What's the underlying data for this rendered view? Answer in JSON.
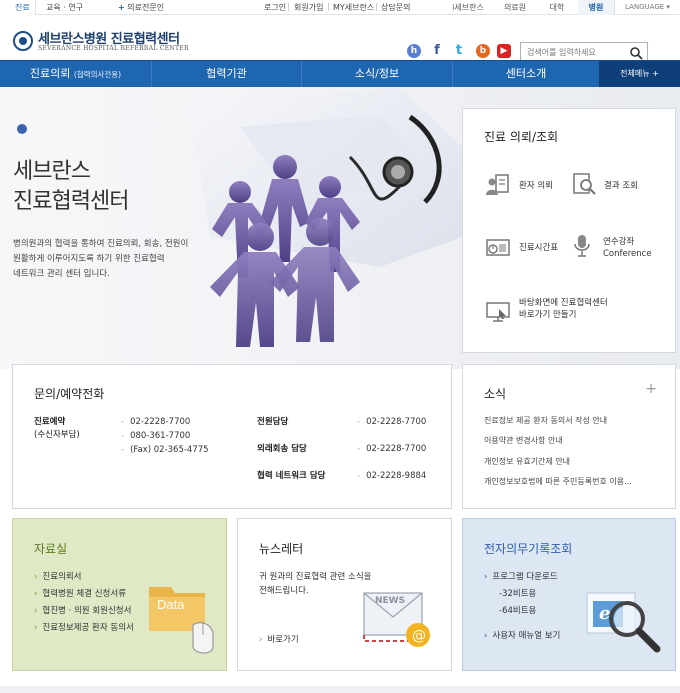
{
  "topbar": {
    "care_tab": "진료",
    "edu": "교육 · 연구",
    "referral_doc": "의료전문인",
    "links": [
      "로그인",
      "회원가입",
      "MY세브란스",
      "상담문의"
    ],
    "sites": [
      "i세브란스",
      "의료원",
      "대학",
      "병원"
    ],
    "language": "LANGUAGE"
  },
  "header": {
    "logo_title": "세브란스병원 진료협력센터",
    "logo_sub": "SEVERANCE HOSPITAL REFERRAL CENTER",
    "search_placeholder": "검색어를 입력하세요",
    "sns": [
      {
        "icon": "home-icon",
        "glyph": "h",
        "color": "#5b7fd0"
      },
      {
        "icon": "facebook-icon",
        "glyph": "f",
        "color": "#3b5998"
      },
      {
        "icon": "twitter-icon",
        "glyph": "t",
        "color": "#2aa9e0"
      },
      {
        "icon": "blog-icon",
        "glyph": "b",
        "color": "#e8661c"
      },
      {
        "icon": "youtube-icon",
        "glyph": "▶",
        "color": "#d22"
      }
    ]
  },
  "nav": {
    "items": [
      {
        "label": "진료의뢰",
        "sub": "(협력의사전용)"
      },
      {
        "label": "협력기관",
        "sub": ""
      },
      {
        "label": "소식/정보",
        "sub": ""
      },
      {
        "label": "센터소개",
        "sub": ""
      }
    ],
    "all_menu": "전체메뉴 +"
  },
  "hero": {
    "title_line1": "세브란스",
    "title_line2": "진료협력센터",
    "desc_line1": "병의원과의 협력을 통하여 진료의뢰, 회송, 전원이",
    "desc_line2": "원활하게 이루어지도록 하기 위한 진료협력",
    "desc_line3": "네트워크 관리 센터 입니다."
  },
  "quick": {
    "title": "진료 의뢰/조회",
    "patient_referral": "환자 의뢰",
    "result_lookup": "결과 조회",
    "schedule": "진료시간표",
    "training_1": "연수강좌",
    "training_2": "Conference",
    "shortcut_1": "바탕화면에 진료협력센터",
    "shortcut_2": "바로가기 만들기"
  },
  "contact": {
    "title": "문의/예약전화",
    "reservation_label_1": "진료예약",
    "reservation_label_2": "(수신자부담)",
    "reservation_phone_1": "02-2228-7700",
    "reservation_phone_2": "080-361-7700",
    "reservation_fax": "(Fax) 02-365-4775",
    "transfer_label": "전원담당",
    "transfer_phone": "02-2228-7700",
    "outpatient_label": "외래회송 담당",
    "outpatient_phone": "02-2228-7700",
    "network_label": "협력 네트워크 담당",
    "network_phone": "02-2228-9884"
  },
  "news": {
    "title": "소식",
    "more": "+",
    "items": [
      "진료정보 제공 환자 동의서 작성 안내",
      "이용약관 변경사항 안내",
      "개인정보 유효기간제 안내",
      "개인정보보호법에 따른 주민등록번호 이용..."
    ]
  },
  "data_room": {
    "title": "자료실",
    "items": [
      "진료의뢰서",
      "협력병원 체결 신청서류",
      "협진병 · 의원 회원신청서",
      "진료정보제공 환자 동의서"
    ],
    "folder_label": "Data"
  },
  "newsletter": {
    "title": "뉴스레터",
    "desc_1": "귀 원과의 진료협력 관련 소식을",
    "desc_2": "전해드립니다.",
    "link": "바로가기",
    "envelope_label": "NEWS"
  },
  "emr": {
    "title": "전자의무기록조회",
    "download": "프로그램 다운로드",
    "bit32": "-32비트용",
    "bit64": "-64비트용",
    "manual": "사용자 매뉴얼 보기"
  },
  "colors": {
    "nav_blue": "#1f66b0",
    "nav_dark": "#0e3f78",
    "data_green": "#e0e9c6",
    "emr_blue": "#dce7f3",
    "emr_title": "#2c5ea8",
    "data_title": "#5a7a1a"
  }
}
